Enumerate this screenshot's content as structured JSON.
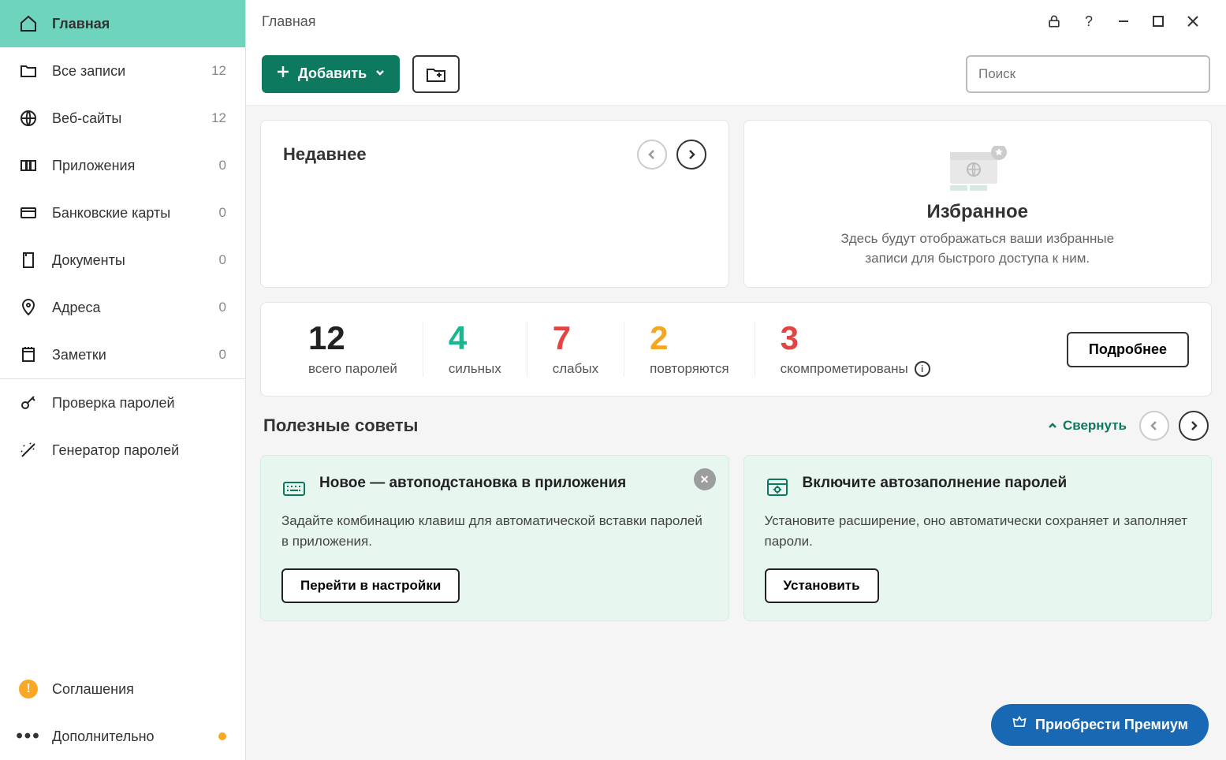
{
  "titlebar": {
    "title": "Главная"
  },
  "sidebar": {
    "items": [
      {
        "label": "Главная",
        "count": ""
      },
      {
        "label": "Все записи",
        "count": "12"
      },
      {
        "label": "Веб-сайты",
        "count": "12"
      },
      {
        "label": "Приложения",
        "count": "0"
      },
      {
        "label": "Банковские карты",
        "count": "0"
      },
      {
        "label": "Документы",
        "count": "0"
      },
      {
        "label": "Адреса",
        "count": "0"
      },
      {
        "label": "Заметки",
        "count": "0"
      }
    ],
    "tools": [
      {
        "label": "Проверка паролей"
      },
      {
        "label": "Генератор паролей"
      }
    ],
    "bottom": [
      {
        "label": "Соглашения"
      },
      {
        "label": "Дополнительно"
      }
    ]
  },
  "toolbar": {
    "add_label": "Добавить",
    "search_placeholder": "Поиск"
  },
  "recent": {
    "title": "Недавнее"
  },
  "favorites": {
    "title": "Избранное",
    "desc": "Здесь будут отображаться ваши избранные записи для быстрого доступа к ним."
  },
  "stats": {
    "total": {
      "num": "12",
      "label": "всего паролей"
    },
    "strong": {
      "num": "4",
      "label": "сильных"
    },
    "weak": {
      "num": "7",
      "label": "слабых"
    },
    "repeat": {
      "num": "2",
      "label": "повторяются"
    },
    "comp": {
      "num": "3",
      "label": "скомпрометированы"
    },
    "more_label": "Подробнее"
  },
  "tips": {
    "title": "Полезные советы",
    "collapse_label": "Свернуть",
    "cards": [
      {
        "title": "Новое — автоподстановка в приложения",
        "desc": "Задайте комбинацию клавиш для автоматической вставки паролей в приложения.",
        "button": "Перейти в настройки"
      },
      {
        "title": "Включите автозаполнение паролей",
        "desc": "Установите расширение, оно автоматически сохраняет и заполняет пароли.",
        "button": "Установить"
      }
    ]
  },
  "premium": {
    "label": "Приобрести Премиум"
  }
}
